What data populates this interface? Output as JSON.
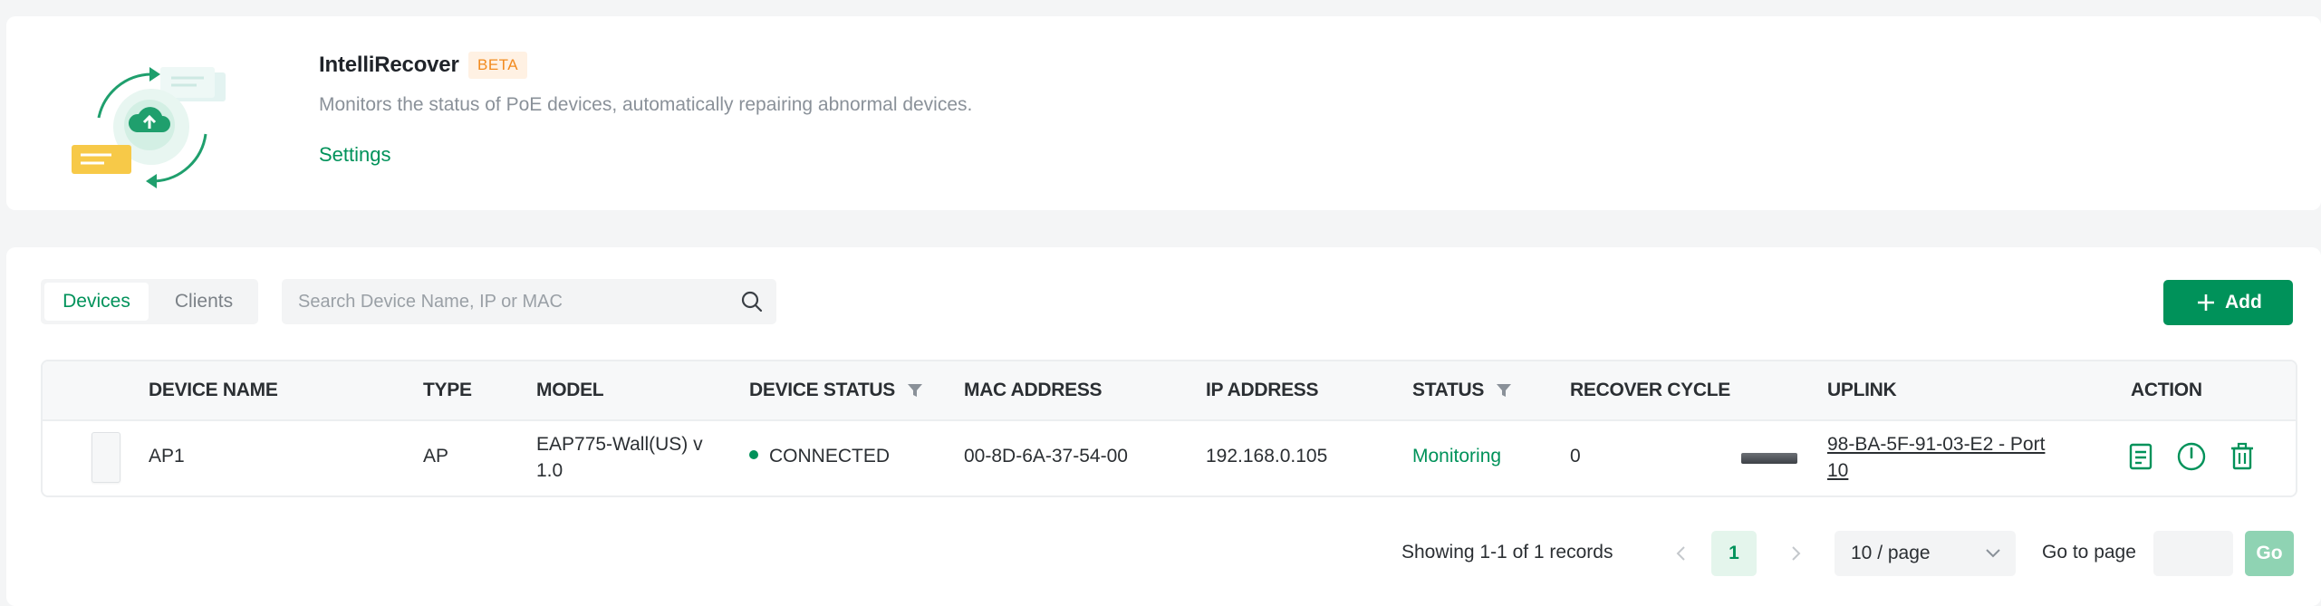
{
  "header": {
    "title": "IntelliRecover",
    "badge": "BETA",
    "description": "Monitors the status of PoE devices, automatically repairing abnormal devices.",
    "settings_link": "Settings",
    "illustration_icon": "cloud-recover-illustration"
  },
  "toolbar": {
    "tabs": [
      {
        "label": "Devices",
        "active": true
      },
      {
        "label": "Clients",
        "active": false
      }
    ],
    "search_placeholder": "Search Device Name, IP or MAC",
    "search_value": "",
    "add_label": "Add"
  },
  "table": {
    "columns": [
      "DEVICE NAME",
      "TYPE",
      "MODEL",
      "DEVICE STATUS",
      "MAC ADDRESS",
      "IP ADDRESS",
      "STATUS",
      "RECOVER CYCLE",
      "UPLINK",
      "ACTION"
    ],
    "rows": [
      {
        "device_name": "AP1",
        "type": "AP",
        "model_line1": "EAP775-Wall(US) v",
        "model_line2": "1.0",
        "device_status": "CONNECTED",
        "mac_address": "00-8D-6A-37-54-00",
        "ip_address": "192.168.0.105",
        "status": "Monitoring",
        "recover_cycle": "0",
        "uplink_line1": "98-BA-5F-91-03-E2 - Port",
        "uplink_line2": "10",
        "actions": [
          "log-icon",
          "power-icon",
          "trash-icon"
        ]
      }
    ]
  },
  "pagination": {
    "summary": "Showing 1-1 of 1 records",
    "current_page": "1",
    "page_size": "10 / page",
    "goto_label": "Go to page",
    "goto_value": "",
    "go_label": "Go"
  },
  "colors": {
    "accent": "#00925a",
    "beta_text": "#f28a1e",
    "beta_bg": "#fff1e3",
    "go_disabled": "#8fd3b3"
  }
}
